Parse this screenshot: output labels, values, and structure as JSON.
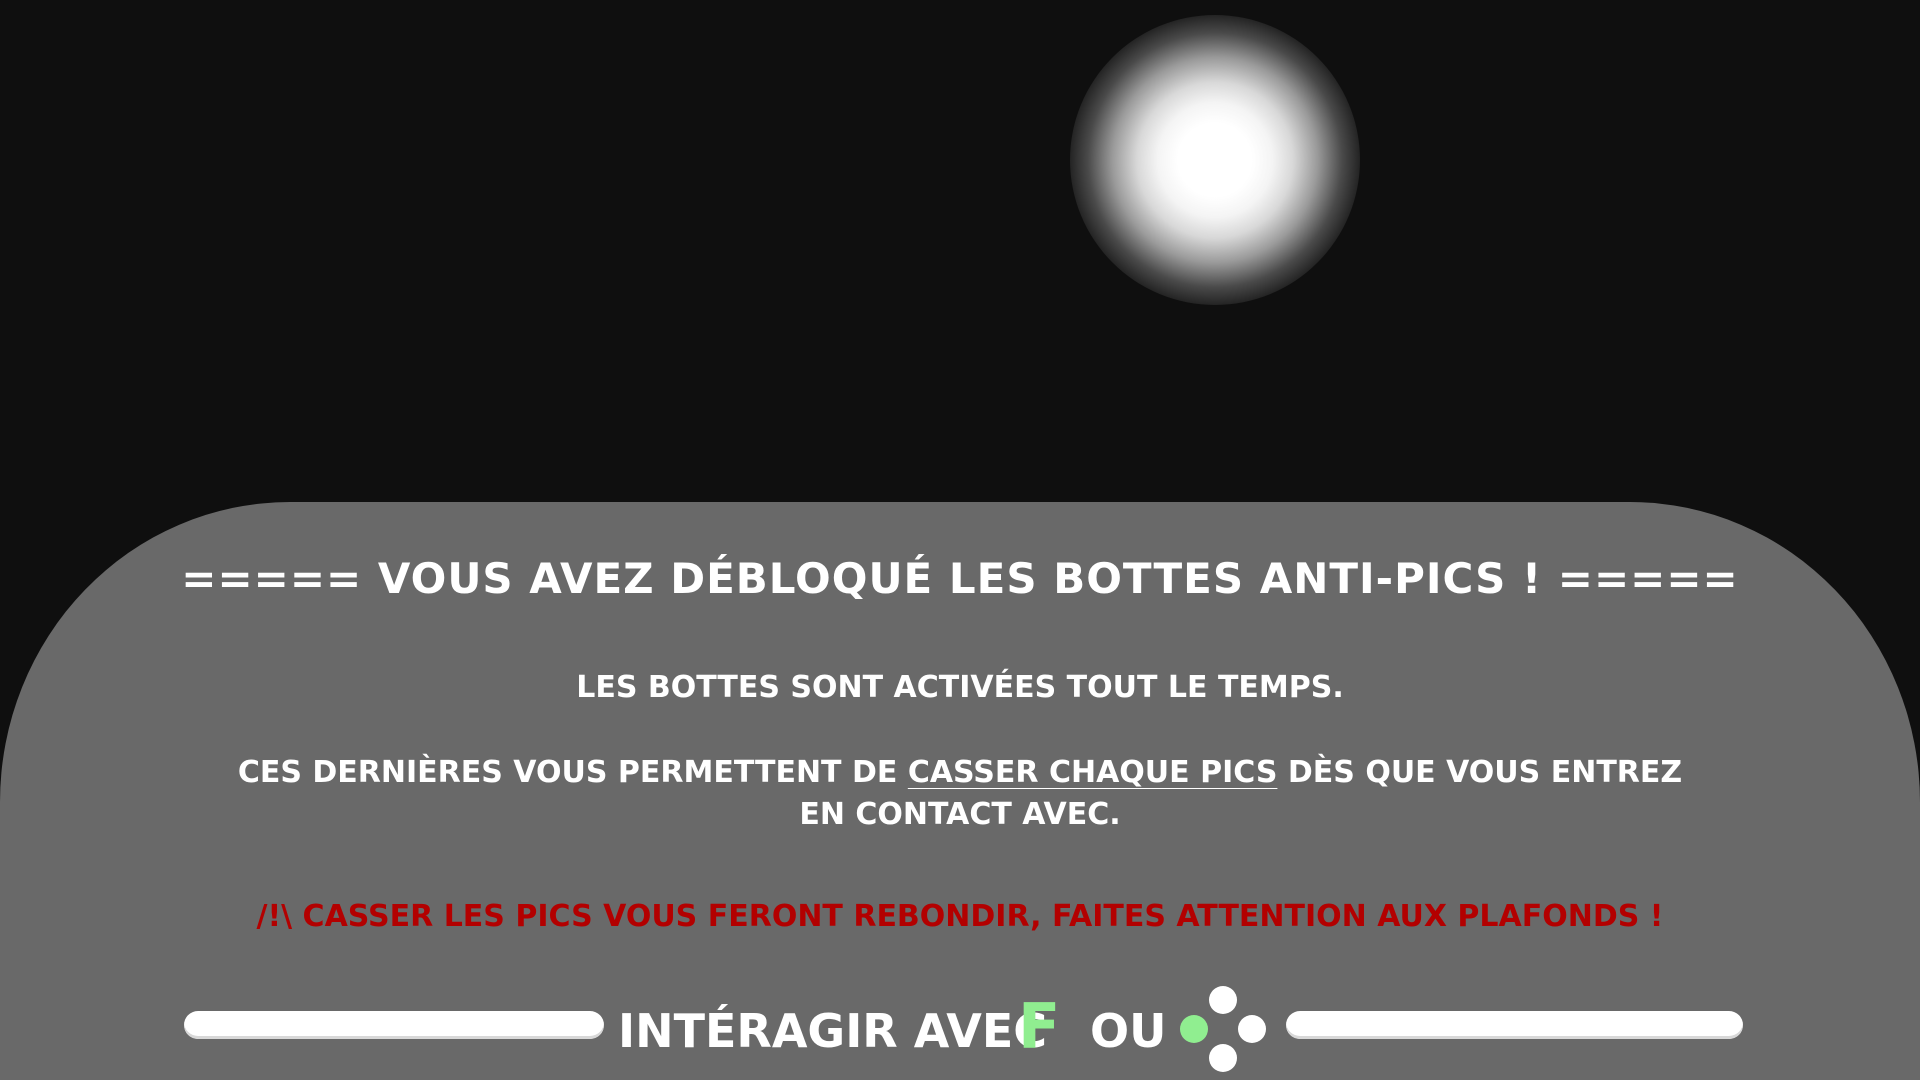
{
  "popup": {
    "title": "===== VOUS AVEZ DÉBLOQUÉ LES BOTTES ANTI-PICS ! =====",
    "line1": "LES BOTTES SONT ACTIVÉES TOUT LE TEMPS.",
    "paragraph": {
      "before": "CES DERNIÈRES VOUS PERMETTENT DE ",
      "highlight": "CASSER CHAQUE PICS",
      "after": " DÈS QUE VOUS ENTREZ EN CONTACT AVEC."
    },
    "warning": "/!\\ CASSER LES PICS VOUS FERONT REBONDIR, FAITES ATTENTION AUX PLAFONDS !"
  },
  "prompt": {
    "label": "INTÉRAGIR AVEC",
    "key": "F",
    "separator": "OU",
    "gamepad_icon": "gamepad-face-buttons-icon"
  },
  "colors": {
    "background": "#0f0f0f",
    "panel": "#696969",
    "text": "#ffffff",
    "warning": "#b30000",
    "accent": "#90ee90"
  }
}
